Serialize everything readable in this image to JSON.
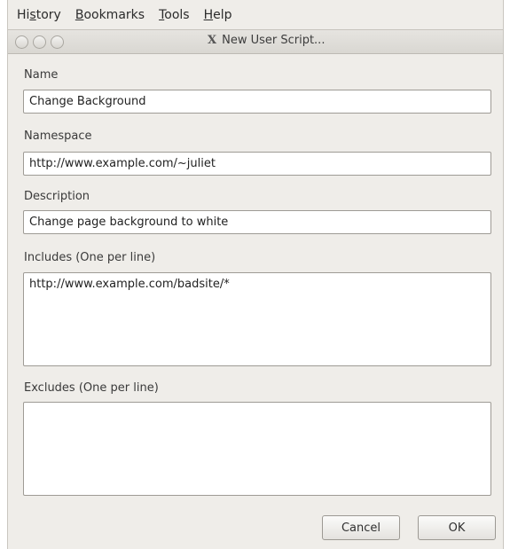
{
  "menu": {
    "history_pre": "Hi",
    "history_mn": "s",
    "history_post": "tory",
    "bookmarks_mn": "B",
    "bookmarks_post": "ookmarks",
    "tools_mn": "T",
    "tools_post": "ools",
    "help_mn": "H",
    "help_post": "elp"
  },
  "window": {
    "title": "New User Script..."
  },
  "form": {
    "name_label": "Name",
    "name_value": "Change Background",
    "namespace_label": "Namespace",
    "namespace_value": "http://www.example.com/~juliet",
    "description_label": "Description",
    "description_value": "Change page background to white",
    "includes_label": "Includes (One per line)",
    "includes_value": "http://www.example.com/badsite/*",
    "excludes_label": "Excludes (One per line)",
    "excludes_value": ""
  },
  "buttons": {
    "cancel": "Cancel",
    "ok": "OK"
  },
  "icons": {
    "window_icon": "x-window-icon"
  }
}
